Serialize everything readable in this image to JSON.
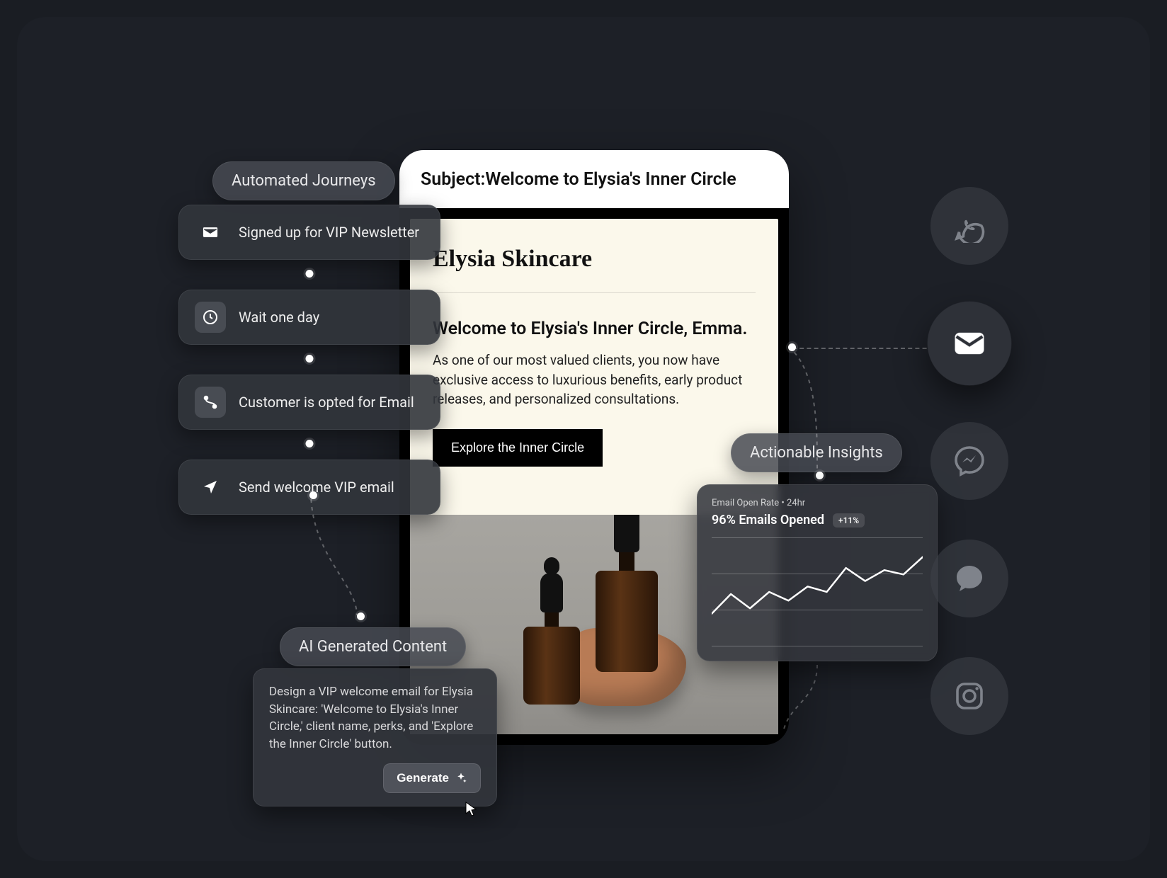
{
  "labels": {
    "automated_journeys": "Automated Journeys",
    "ai_generated_content": "AI Generated Content",
    "actionable_insights": "Actionable Insights"
  },
  "journey": {
    "steps": [
      {
        "label": "Signed up for VIP Newsletter",
        "icon": "mail"
      },
      {
        "label": "Wait one day",
        "icon": "clock"
      },
      {
        "label": "Customer is opted for Email",
        "icon": "branch"
      },
      {
        "label": "Send welcome VIP email",
        "icon": "send"
      }
    ]
  },
  "email": {
    "subject_prefix": "Subject: ",
    "subject": "Welcome to Elysia's Inner Circle",
    "brand": "Elysia Skincare",
    "greeting": "Welcome to Elysia's Inner Circle, Emma.",
    "body": "As one of our most valued clients, you now have exclusive access to luxurious benefits, early product releases, and personalized consultations.",
    "cta": "Explore the Inner Circle"
  },
  "ai": {
    "prompt": "Design a VIP welcome email for Elysia Skincare: 'Welcome to Elysia's Inner Circle,' client name, perks, and 'Explore the Inner Circle' button.",
    "generate_label": "Generate"
  },
  "insights": {
    "sub": "Email Open Rate • 24hr",
    "headline": "96% Emails Opened",
    "delta": "+11%"
  },
  "chart_data": {
    "type": "line",
    "title": "Email Open Rate • 24hr",
    "xlabel": "",
    "ylabel": "",
    "ylim": [
      0,
      100
    ],
    "x": [
      0,
      1,
      2,
      3,
      4,
      5,
      6,
      7,
      8,
      9,
      10,
      11
    ],
    "values": [
      30,
      48,
      35,
      50,
      42,
      55,
      50,
      72,
      60,
      70,
      66,
      82
    ]
  },
  "channels": [
    "whatsapp",
    "email",
    "messenger",
    "chat",
    "instagram"
  ],
  "active_channel": "email"
}
